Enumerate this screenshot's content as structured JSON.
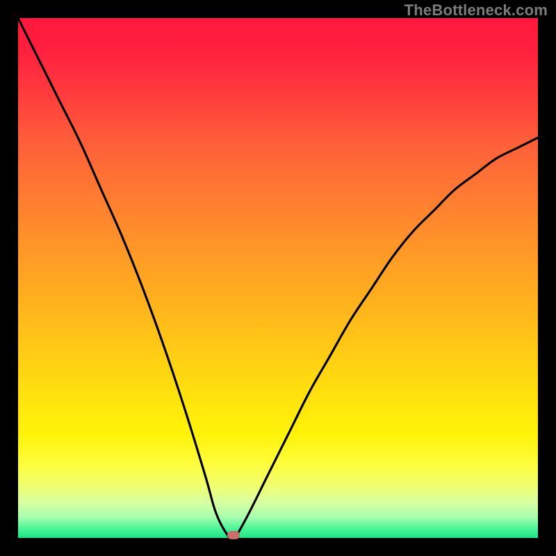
{
  "watermark": "TheBottleneck.com",
  "colors": {
    "frame": "#000000",
    "curve": "#000000",
    "marker": "#cd6f6a",
    "gradient_top": "#ff173e",
    "gradient_bottom": "#18e886"
  },
  "chart_data": {
    "type": "line",
    "title": "",
    "xlabel": "",
    "ylabel": "",
    "xlim": [
      0,
      100
    ],
    "ylim": [
      0,
      100
    ],
    "series": [
      {
        "name": "bottleneck-curve",
        "x": [
          0,
          4,
          8,
          12,
          16,
          20,
          24,
          28,
          32,
          36,
          38,
          40,
          41.5,
          44,
          48,
          52,
          56,
          60,
          64,
          68,
          72,
          76,
          80,
          84,
          88,
          92,
          96,
          100
        ],
        "y": [
          100,
          92,
          84,
          76,
          67,
          58,
          48,
          37,
          25,
          12,
          5,
          1,
          0,
          4,
          12,
          20,
          28,
          35,
          42,
          48,
          54,
          59,
          63,
          67,
          70,
          73,
          75,
          77
        ]
      }
    ],
    "marker": {
      "x": 41.5,
      "y": 0.5
    },
    "annotations": [],
    "legend": null,
    "grid": false
  }
}
